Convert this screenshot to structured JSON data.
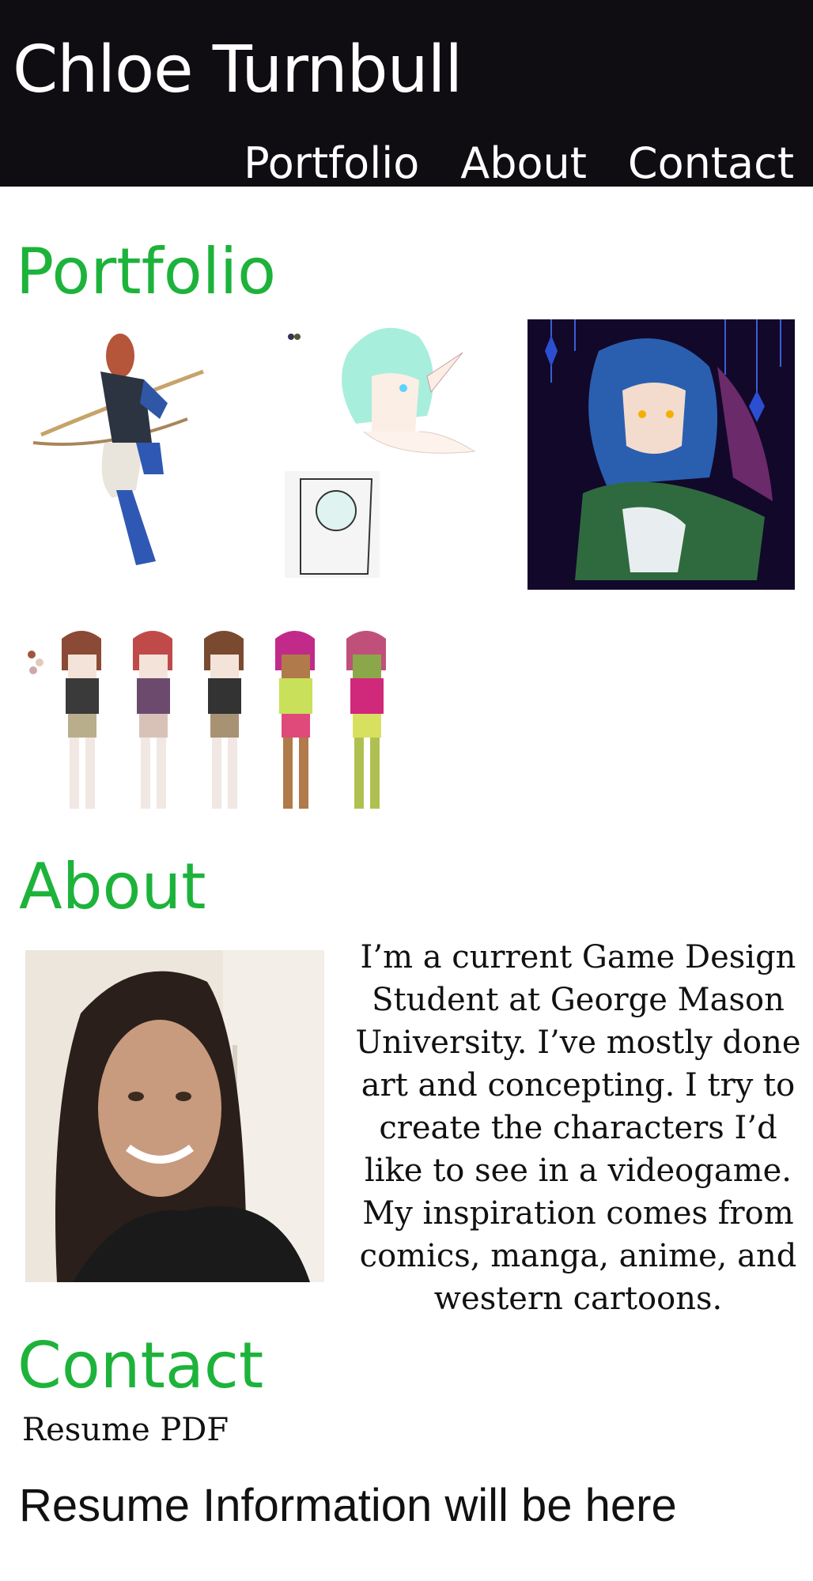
{
  "header": {
    "title": "Chloe Turnbull",
    "nav": [
      "Portfolio",
      "About",
      "Contact"
    ]
  },
  "portfolio": {
    "heading": "Portfolio",
    "images": [
      {
        "name": "archer-art-image"
      },
      {
        "name": "elf-sketch-image"
      },
      {
        "name": "dark-elf-art-image"
      },
      {
        "name": "character-palette-image"
      }
    ]
  },
  "about": {
    "heading": "About",
    "photo_name": "profile-photo",
    "bio": "I’m a current Game Design Student at George Mason University. I’ve mostly done art and concepting. I try to create the characters I’d like to see in a videogame. My inspiration comes from comics, manga, anime, and western cartoons."
  },
  "contact": {
    "heading": "Contact",
    "resume_link": "Resume PDF",
    "resume_info": "Resume Information will be here"
  },
  "colors": {
    "header_bg": "#0f0c12",
    "accent_green": "#1db33b",
    "text": "#111111"
  }
}
